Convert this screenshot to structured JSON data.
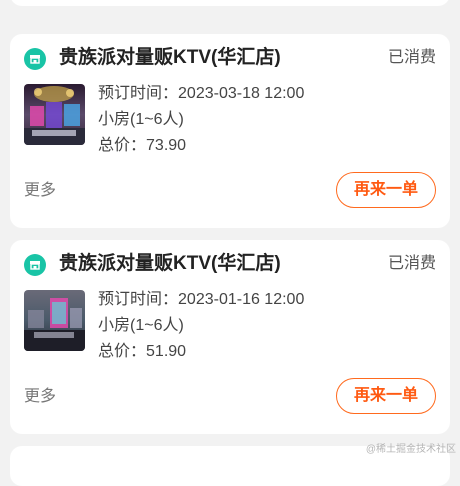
{
  "orders": [
    {
      "shop_name": "贵族派对量贩KTV(华汇店)",
      "status": "已消费",
      "booking_label": "预订时间：",
      "booking_time": "2023-03-18 12:00",
      "room": "小房(1~6人)",
      "total_label": "总价：",
      "total": "73.90",
      "more_label": "更多",
      "button_label": "再来一单"
    },
    {
      "shop_name": "贵族派对量贩KTV(华汇店)",
      "status": "已消费",
      "booking_label": "预订时间：",
      "booking_time": "2023-01-16 12:00",
      "room": "小房(1~6人)",
      "total_label": "总价：",
      "total": "51.90",
      "more_label": "更多",
      "button_label": "再来一单"
    }
  ],
  "watermark": "@稀土掘金技术社区",
  "colors": {
    "accent": "#ff6a1e",
    "shop_icon": "#19c4a6",
    "background": "#f2f2f2"
  },
  "icons": {
    "shop": "store-icon"
  }
}
